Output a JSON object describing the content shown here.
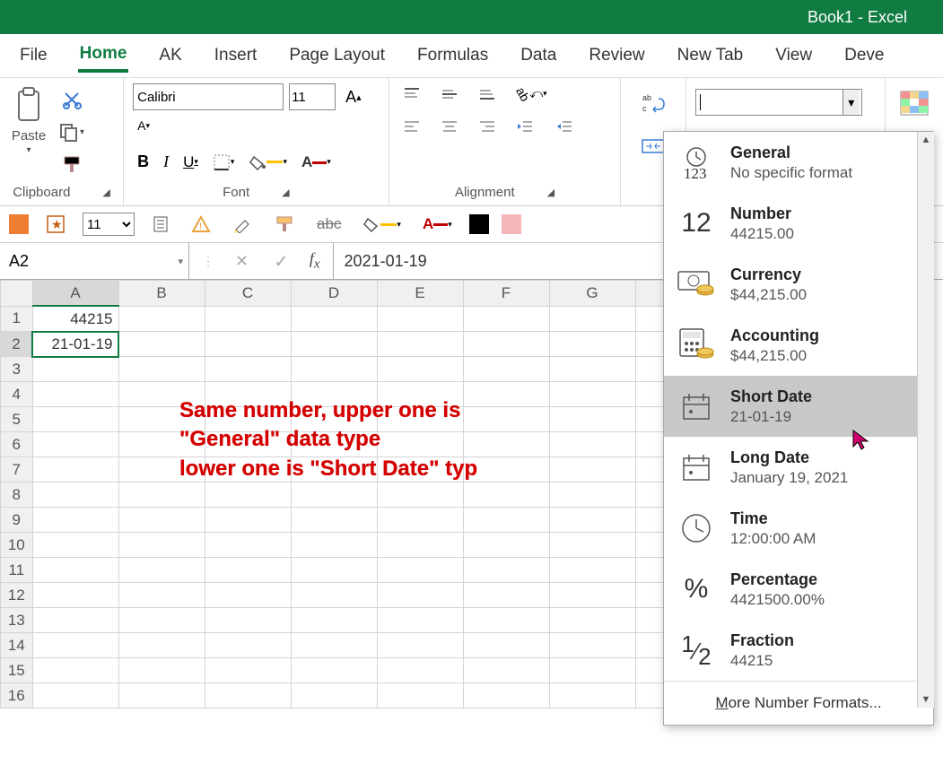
{
  "title": "Book1  -  Excel",
  "tabs": [
    "File",
    "Home",
    "AK",
    "Insert",
    "Page Layout",
    "Formulas",
    "Data",
    "Review",
    "New Tab",
    "View",
    "Deve"
  ],
  "active_tab": "Home",
  "groups": {
    "clipboard": "Clipboard",
    "font": "Font",
    "alignment": "Alignment"
  },
  "clipboard": {
    "paste": "Paste"
  },
  "font": {
    "name": "Calibri",
    "size": "11",
    "bold": "B",
    "italic": "I",
    "underline": "U"
  },
  "qat": {
    "size": "11"
  },
  "namebox": "A2",
  "formula": "2021-01-19",
  "columns": [
    "A",
    "B",
    "C",
    "D",
    "E",
    "F",
    "G"
  ],
  "rows": [
    "1",
    "2",
    "3",
    "4",
    "5",
    "6",
    "7",
    "8",
    "9",
    "10",
    "11",
    "12",
    "13",
    "14",
    "15",
    "16"
  ],
  "cells": {
    "A1": "44215",
    "A2": "21-01-19"
  },
  "annotation": {
    "l1": "Same number, upper one is",
    "l2": "\"General\" data type",
    "l3": "lower one is \"Short Date\" typ"
  },
  "number_format_input": "",
  "formats": [
    {
      "key": "general",
      "title": "General",
      "sub": "No specific format",
      "icon": "123c"
    },
    {
      "key": "number",
      "title": "Number",
      "sub": "44215.00",
      "icon": "12"
    },
    {
      "key": "currency",
      "title": "Currency",
      "sub": "$44,215.00",
      "icon": "cash"
    },
    {
      "key": "accounting",
      "title": "Accounting",
      "sub": " $44,215.00",
      "icon": "acct"
    },
    {
      "key": "shortdate",
      "title": "Short Date",
      "sub": "21-01-19",
      "icon": "cal",
      "hover": true
    },
    {
      "key": "longdate",
      "title": "Long Date",
      "sub": "January 19, 2021",
      "icon": "cal"
    },
    {
      "key": "time",
      "title": "Time",
      "sub": "12:00:00 AM",
      "icon": "clock"
    },
    {
      "key": "percentage",
      "title": "Percentage",
      "sub": "4421500.00%",
      "icon": "pct"
    },
    {
      "key": "fraction",
      "title": "Fraction",
      "sub": "44215",
      "icon": "frac"
    }
  ],
  "more_formats_label": "ore Number Formats...",
  "more_formats_prefix": "M",
  "chart_data": null
}
